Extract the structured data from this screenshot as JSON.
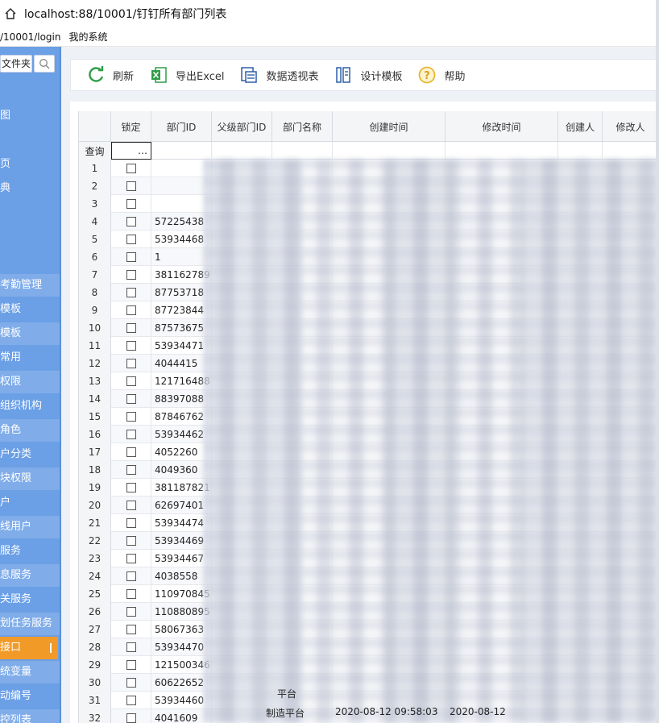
{
  "window": {
    "title": "localhost:88/10001/钉钉所有部门列表",
    "url": "/10001/login",
    "system_label": "我的系统"
  },
  "sidebar": {
    "search_value": "文件夹",
    "items": [
      {
        "label": "图",
        "alt": false
      },
      {
        "label": "",
        "alt": false
      },
      {
        "label": "页",
        "alt": false
      },
      {
        "label": "典",
        "alt": false
      },
      {
        "label": "",
        "alt": false
      },
      {
        "label": "",
        "alt": false
      },
      {
        "label": "",
        "alt": false
      },
      {
        "label": "考勤管理",
        "alt": true
      },
      {
        "label": "模板",
        "alt": false
      },
      {
        "label": "模板",
        "alt": true
      },
      {
        "label": "常用",
        "alt": false
      },
      {
        "label": "权限",
        "alt": true
      },
      {
        "label": "组织机构",
        "alt": false
      },
      {
        "label": "角色",
        "alt": true
      },
      {
        "label": "户分类",
        "alt": false
      },
      {
        "label": "块权限",
        "alt": true
      },
      {
        "label": "户",
        "alt": false
      },
      {
        "label": "线用户",
        "alt": true
      },
      {
        "label": "服务",
        "alt": false
      },
      {
        "label": "息服务",
        "alt": true
      },
      {
        "label": "关服务",
        "alt": false
      },
      {
        "label": "划任务服务",
        "alt": true
      },
      {
        "label": "接口",
        "alt": false,
        "active": true
      },
      {
        "label": "统变量",
        "alt": true
      },
      {
        "label": "动编号",
        "alt": false
      },
      {
        "label": "控列表",
        "alt": true
      }
    ]
  },
  "toolbar": {
    "buttons": [
      {
        "label": "刷新",
        "icon": "refresh-icon",
        "color": "#2e9d47"
      },
      {
        "label": "导出Excel",
        "icon": "excel-icon",
        "color": "#2e9d47"
      },
      {
        "label": "数据透视表",
        "icon": "pivot-table-icon",
        "color": "#2d5fa8"
      },
      {
        "label": "设计模板",
        "icon": "design-template-icon",
        "color": "#2d5fa8"
      },
      {
        "label": "帮助",
        "icon": "help-icon",
        "color": "#e8b730"
      }
    ]
  },
  "grid": {
    "columns": [
      "",
      "锁定",
      "部门ID",
      "父级部门ID",
      "部门名称",
      "创建时间",
      "修改时间",
      "创建人",
      "修改人"
    ],
    "query_label": "查询",
    "query_lock_value": "…",
    "rows": [
      {
        "n": "1",
        "id": ""
      },
      {
        "n": "2",
        "id": ""
      },
      {
        "n": "3",
        "id": ""
      },
      {
        "n": "4",
        "id": "57225438"
      },
      {
        "n": "5",
        "id": "53934468"
      },
      {
        "n": "6",
        "id": "1"
      },
      {
        "n": "7",
        "id": "381162789"
      },
      {
        "n": "8",
        "id": "87753718"
      },
      {
        "n": "9",
        "id": "87723844"
      },
      {
        "n": "10",
        "id": "87573675"
      },
      {
        "n": "11",
        "id": "53934471"
      },
      {
        "n": "12",
        "id": "4044415"
      },
      {
        "n": "13",
        "id": "121716488"
      },
      {
        "n": "14",
        "id": "88397088"
      },
      {
        "n": "15",
        "id": "87846762"
      },
      {
        "n": "16",
        "id": "53934462"
      },
      {
        "n": "17",
        "id": "4052260"
      },
      {
        "n": "18",
        "id": "4049360"
      },
      {
        "n": "19",
        "id": "381187821"
      },
      {
        "n": "20",
        "id": "62697401"
      },
      {
        "n": "21",
        "id": "53934474"
      },
      {
        "n": "22",
        "id": "53934469"
      },
      {
        "n": "23",
        "id": "53934467"
      },
      {
        "n": "24",
        "id": "4038558"
      },
      {
        "n": "25",
        "id": "110970845"
      },
      {
        "n": "26",
        "id": "110880895"
      },
      {
        "n": "27",
        "id": "58067363"
      },
      {
        "n": "28",
        "id": "53934470"
      },
      {
        "n": "29",
        "id": "121500346"
      },
      {
        "n": "30",
        "id": "60622652"
      },
      {
        "n": "31",
        "id": "53934460"
      },
      {
        "n": "32",
        "id": "4041609"
      }
    ],
    "visible_fragments": {
      "row30_name": "平台",
      "row32_name": "制造平台",
      "row32_created": "2020-08-12 09:58:03",
      "row32_modified": "2020-08-12"
    }
  }
}
